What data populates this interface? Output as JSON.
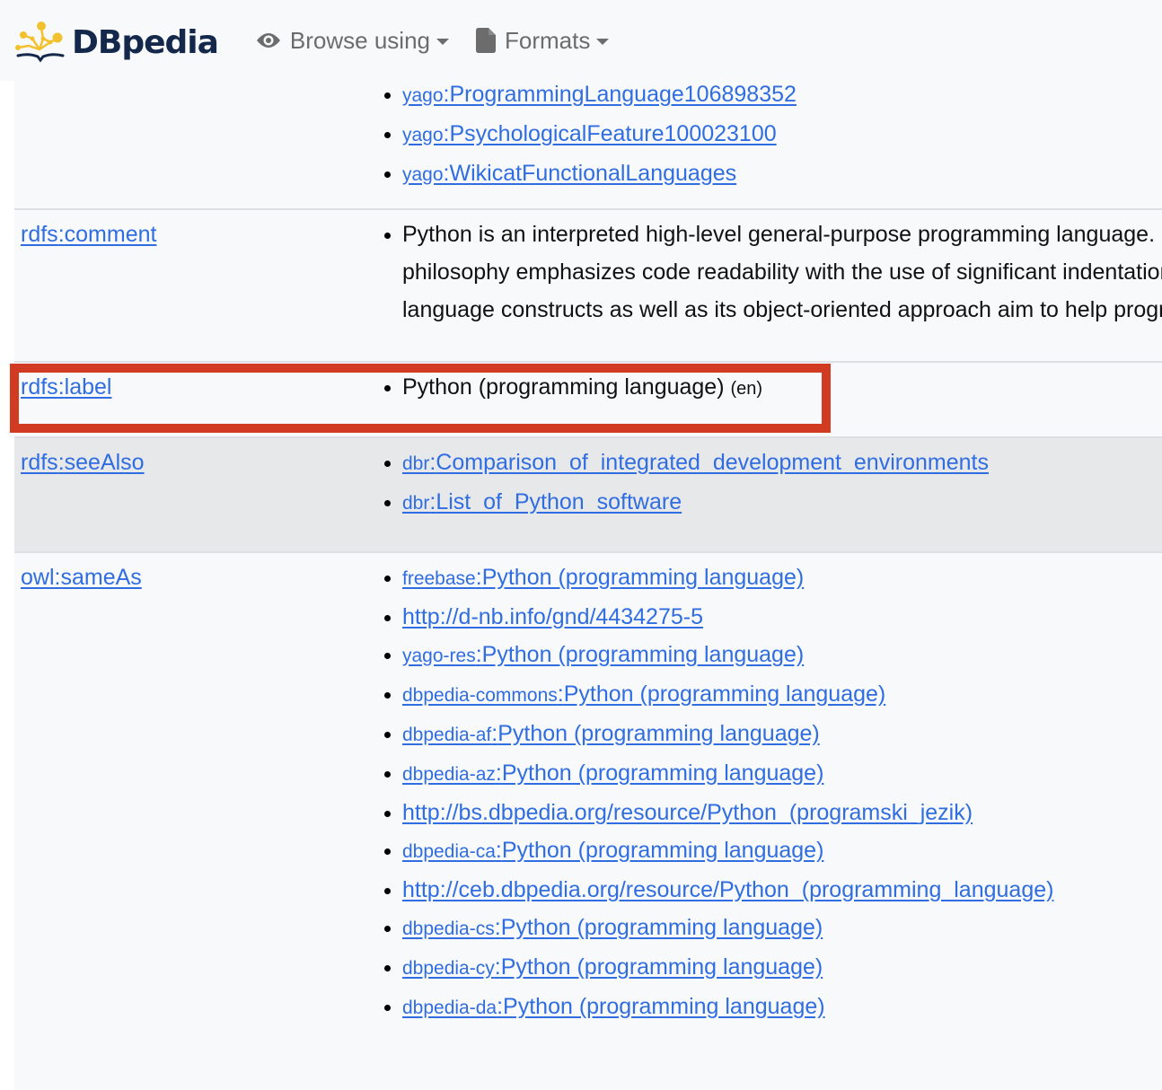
{
  "navbar": {
    "brand": "DBpedia",
    "browse_using": "Browse using",
    "formats": "Formats"
  },
  "rows": {
    "types": {
      "values": [
        {
          "prefix": "yago",
          "local": "ProgrammingLanguage106898352"
        },
        {
          "prefix": "yago",
          "local": "PsychologicalFeature100023100"
        },
        {
          "prefix": "yago",
          "local": "WikicatFunctionalLanguages"
        }
      ]
    },
    "comment": {
      "prefix": "rdfs",
      "local": "comment",
      "text": "Python is an interpreted high-level general-purpose programming language. Its design philosophy emphasizes code readability with the use of significant indentation. Its language constructs as well as its object-oriented approach aim to help programmers write clear, logical code for small and large-scale projects. Python consistently ranks as one of the most popular programming languages."
    },
    "label": {
      "prefix": "rdfs",
      "local": "label",
      "value": "Python (programming language)",
      "lang": "(en)"
    },
    "seeAlso": {
      "prefix": "rdfs",
      "local": "seeAlso",
      "values": [
        {
          "prefix": "dbr",
          "local": "Comparison_of_integrated_development_environments"
        },
        {
          "prefix": "dbr",
          "local": "List_of_Python_software"
        }
      ]
    },
    "sameAs": {
      "prefix": "owl",
      "local": "sameAs",
      "values": [
        {
          "prefix": "freebase",
          "local": "Python (programming language)"
        },
        {
          "prefix": "",
          "local": "http://d-nb.info/gnd/4434275-5"
        },
        {
          "prefix": "yago-res",
          "local": "Python (programming language)"
        },
        {
          "prefix": "dbpedia-commons",
          "local": "Python (programming language)"
        },
        {
          "prefix": "dbpedia-af",
          "local": "Python (programming language)"
        },
        {
          "prefix": "dbpedia-az",
          "local": "Python (programming language)"
        },
        {
          "prefix": "",
          "local": "http://bs.dbpedia.org/resource/Python_(programski_jezik)"
        },
        {
          "prefix": "dbpedia-ca",
          "local": "Python (programming language)"
        },
        {
          "prefix": "",
          "local": "http://ceb.dbpedia.org/resource/Python_(programming_language)"
        },
        {
          "prefix": "dbpedia-cs",
          "local": "Python (programming language)"
        },
        {
          "prefix": "dbpedia-cy",
          "local": "Python (programming language)"
        },
        {
          "prefix": "dbpedia-da",
          "local": "Python (programming language)"
        }
      ]
    }
  },
  "colors": {
    "link": "#2f6de1",
    "highlight": "#d03b22",
    "brand_dark": "#14284b",
    "brand_gold": "#f2c12e"
  }
}
